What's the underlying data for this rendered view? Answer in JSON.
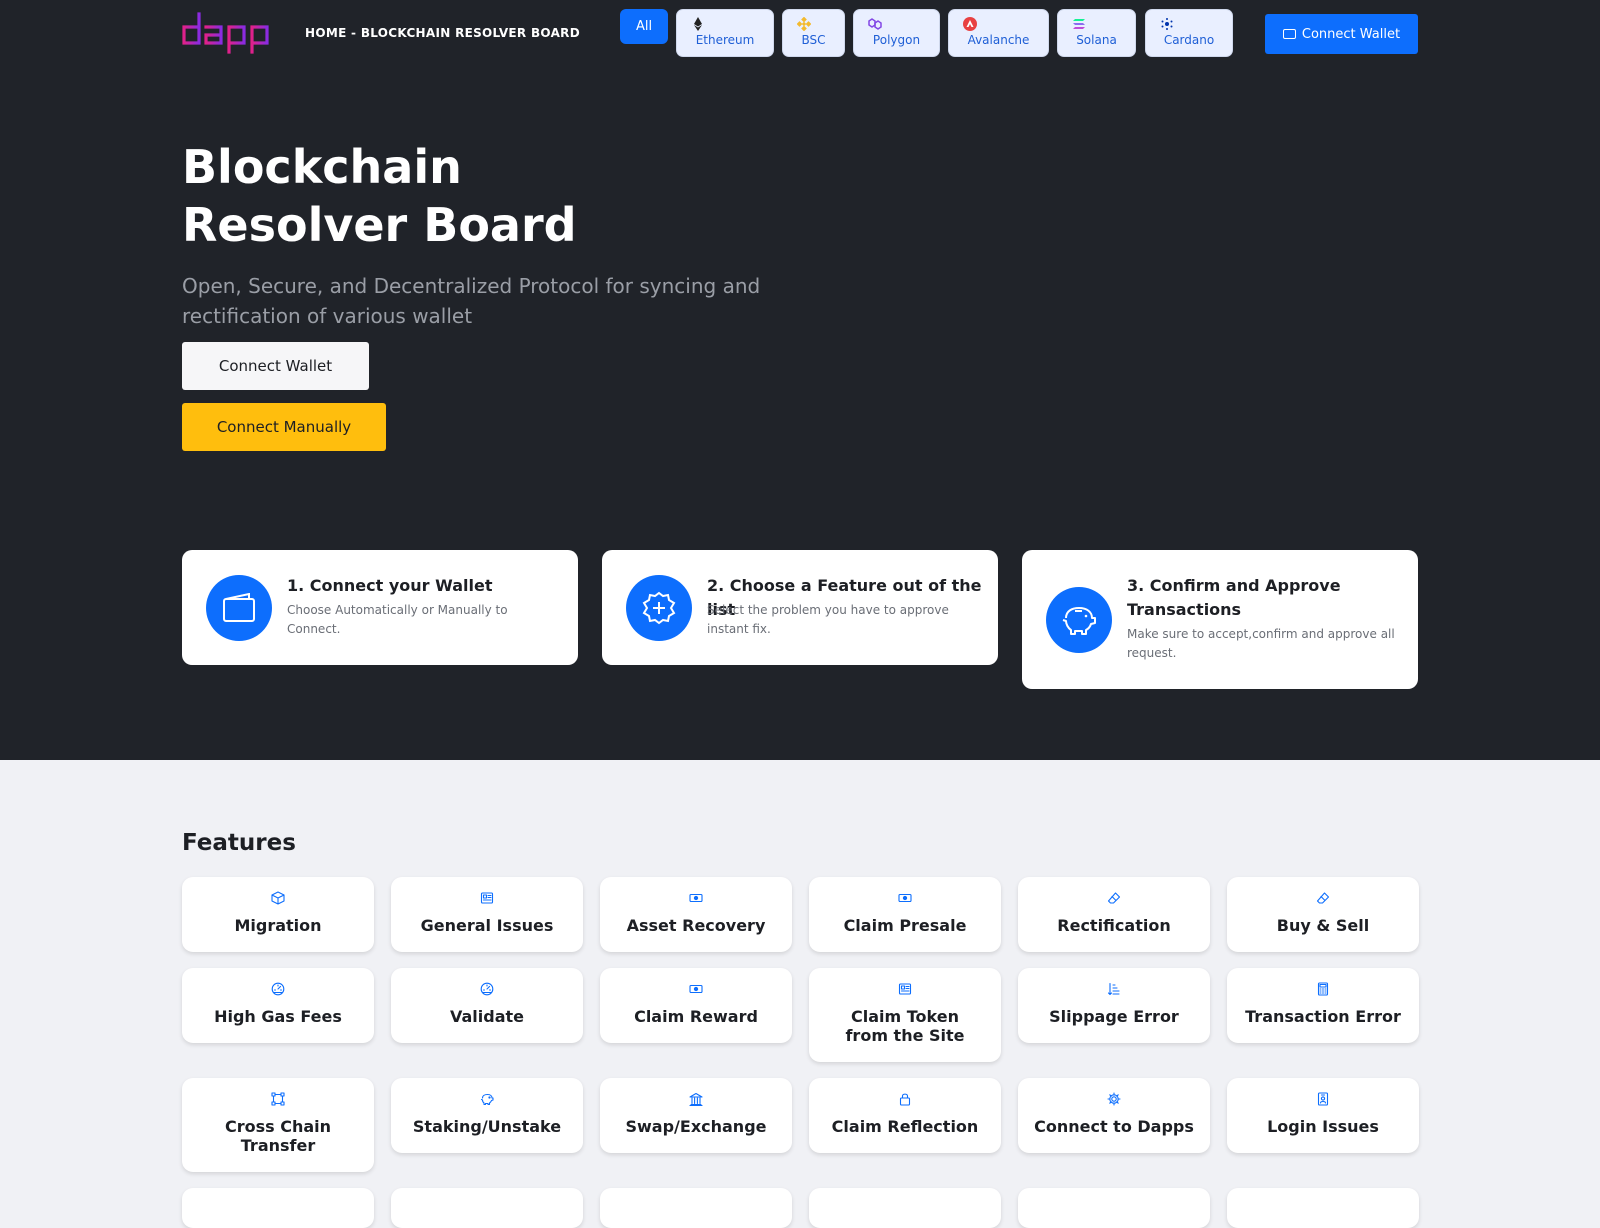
{
  "nav": {
    "breadcrumb": "HOME - BLOCKCHAIN RESOLVER BOARD",
    "chains": {
      "all": "All",
      "items": [
        {
          "label": "Ethereum",
          "icon": "ethereum-icon"
        },
        {
          "label": "BSC",
          "icon": "bsc-icon"
        },
        {
          "label": "Polygon",
          "icon": "polygon-icon"
        },
        {
          "label": "Avalanche",
          "icon": "avalanche-icon"
        },
        {
          "label": "Solana",
          "icon": "solana-icon"
        },
        {
          "label": "Cardano",
          "icon": "cardano-icon"
        }
      ]
    },
    "connect_label": "Connect Wallet"
  },
  "hero": {
    "title_line1": "Blockchain",
    "title_line2": "Resolver Board",
    "subtitle": "Open, Secure, and Decentralized Protocol for syncing and rectification of various wallet",
    "connect_wallet": "Connect Wallet",
    "connect_manually": "Connect Manually"
  },
  "steps": [
    {
      "title": "1. Connect your Wallet",
      "desc": "Choose Automatically or Manually to Connect.",
      "icon": "wallet-icon"
    },
    {
      "title": "2. Choose a Feature out of the list",
      "desc": "Select the problem you have to approve instant fix.",
      "icon": "plus-badge-icon"
    },
    {
      "title": "3. Confirm and Approve Transactions",
      "desc": "Make sure to accept,confirm and approve all request.",
      "icon": "piggy-bank-icon"
    }
  ],
  "features": {
    "title": "Features",
    "items": [
      {
        "label": "Migration",
        "icon": "box-icon"
      },
      {
        "label": "General Issues",
        "icon": "newspaper-icon"
      },
      {
        "label": "Asset Recovery",
        "icon": "cash-icon"
      },
      {
        "label": "Claim Presale",
        "icon": "cash-icon"
      },
      {
        "label": "Rectification",
        "icon": "eraser-icon"
      },
      {
        "label": "Buy & Sell",
        "icon": "eraser-icon"
      },
      {
        "label": "High Gas Fees",
        "icon": "speedometer-icon"
      },
      {
        "label": "Validate",
        "icon": "speedometer-icon"
      },
      {
        "label": "Claim Reward",
        "icon": "cash-icon"
      },
      {
        "label": "Claim Token from the Site",
        "icon": "newspaper-icon"
      },
      {
        "label": "Slippage Error",
        "icon": "sort-icon"
      },
      {
        "label": "Transaction Error",
        "icon": "calculator-icon"
      },
      {
        "label": "Cross Chain Transfer",
        "icon": "bounding-box-icon"
      },
      {
        "label": "Staking/Unstake",
        "icon": "piggy-icon"
      },
      {
        "label": "Swap/Exchange",
        "icon": "bank-icon"
      },
      {
        "label": "Claim Reflection",
        "icon": "lock-icon"
      },
      {
        "label": "Connect to Dapps",
        "icon": "gear-icon"
      },
      {
        "label": "Login Issues",
        "icon": "person-badge-icon"
      }
    ]
  },
  "colors": {
    "dark_bg": "#202329",
    "light_bg": "#f0f1f5",
    "accent_blue": "#0d6efd",
    "accent_yellow": "#ffbe0d",
    "logo_gradient": [
      "#e0218a",
      "#8a2be2"
    ]
  }
}
